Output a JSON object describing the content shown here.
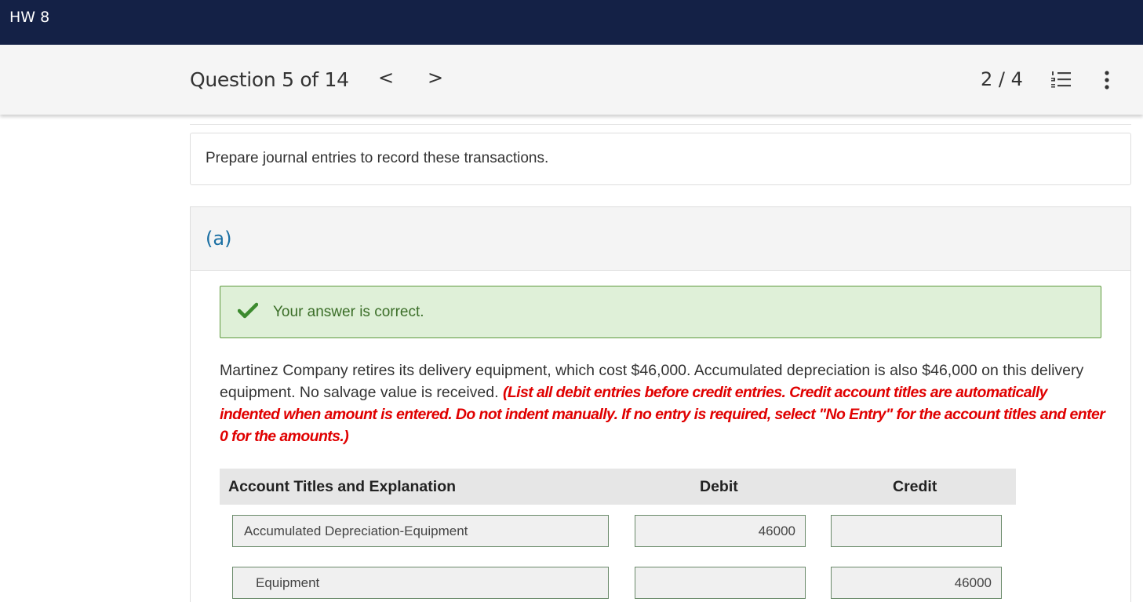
{
  "app": {
    "title": "HW 8"
  },
  "question_bar": {
    "label": "Question 5 of 14",
    "prev": "<",
    "next": ">",
    "progress": "2 / 4"
  },
  "prompt": "Prepare journal entries to record these transactions.",
  "part": {
    "label": "(a)",
    "feedback": "Your answer is correct.",
    "problem_text": "Martinez Company retires its delivery equipment, which cost $46,000. Accumulated depreciation is also $46,000 on this delivery equipment. No salvage value is received.",
    "instructions": "(List all debit entries before credit entries. Credit account titles are automatically indented when amount is entered. Do not indent manually. If no entry is required, select \"No Entry\" for the account titles and enter 0 for the amounts.)"
  },
  "table": {
    "headers": {
      "account": "Account Titles and Explanation",
      "debit": "Debit",
      "credit": "Credit"
    },
    "rows": [
      {
        "account": "Accumulated Depreciation-Equipment",
        "debit": "46000",
        "credit": ""
      },
      {
        "account": "Equipment",
        "debit": "",
        "credit": "46000"
      }
    ]
  },
  "colors": {
    "topbar": "#142146",
    "link": "#1a6fa3",
    "success_bg": "#dff0d8",
    "success_text": "#3b6e28",
    "instruction_red": "#e00000"
  },
  "icons": {
    "prev": "chevron-left-icon",
    "next": "chevron-right-icon",
    "list": "numbered-list-icon",
    "more": "more-vertical-icon",
    "check": "checkmark-icon"
  }
}
